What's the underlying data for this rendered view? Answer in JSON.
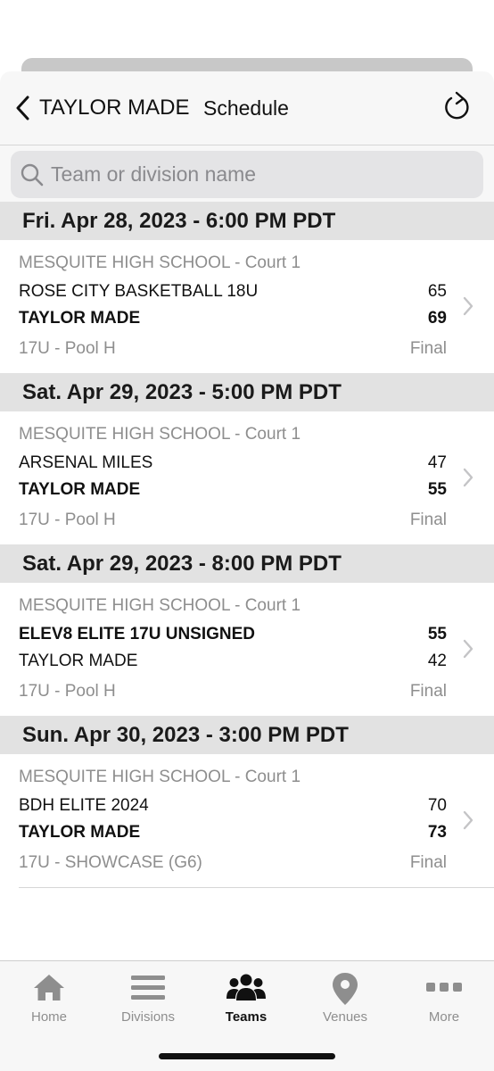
{
  "header": {
    "team_name": "TAYLOR MADE",
    "page_title": "Schedule"
  },
  "search": {
    "placeholder": "Team or division name",
    "value": ""
  },
  "days": [
    {
      "date": "Fri. Apr 28, 2023 - 6:00 PM PDT",
      "game": {
        "venue": "MESQUITE HIGH SCHOOL - Court 1",
        "team1": "ROSE CITY BASKETBALL 18U",
        "score1": "65",
        "team2": "TAYLOR MADE",
        "score2": "69",
        "division": "17U - Pool H",
        "status": "Final"
      }
    },
    {
      "date": "Sat. Apr 29, 2023 - 5:00 PM PDT",
      "game": {
        "venue": "MESQUITE HIGH SCHOOL - Court 1",
        "team1": "ARSENAL MILES",
        "score1": "47",
        "team2": "TAYLOR MADE",
        "score2": "55",
        "division": "17U - Pool H",
        "status": "Final"
      }
    },
    {
      "date": "Sat. Apr 29, 2023 - 8:00 PM PDT",
      "game": {
        "venue": "MESQUITE HIGH SCHOOL - Court 1",
        "team1": "ELEV8 ELITE 17U UNSIGNED",
        "score1": "55",
        "team2": "TAYLOR MADE",
        "score2": "42",
        "division": "17U - Pool H",
        "status": "Final"
      }
    },
    {
      "date": "Sun. Apr 30, 2023 - 3:00 PM PDT",
      "game": {
        "venue": "MESQUITE HIGH SCHOOL - Court 1",
        "team1": "BDH ELITE 2024",
        "score1": "70",
        "team2": "TAYLOR MADE",
        "score2": "73",
        "division": "17U - SHOWCASE (G6)",
        "status": "Final"
      }
    }
  ],
  "tabbar": {
    "items": [
      {
        "label": "Home",
        "icon": "house-icon"
      },
      {
        "label": "Divisions",
        "icon": "list-icon"
      },
      {
        "label": "Teams",
        "icon": "people-icon",
        "active": true
      },
      {
        "label": "Venues",
        "icon": "map-pin-icon"
      },
      {
        "label": "More",
        "icon": "ellipsis-icon"
      }
    ]
  },
  "colors": {
    "accent": "#111111",
    "inactive": "#8e8e8e",
    "section_bg": "#e2e2e2",
    "bar_bg": "#f7f7f7"
  }
}
